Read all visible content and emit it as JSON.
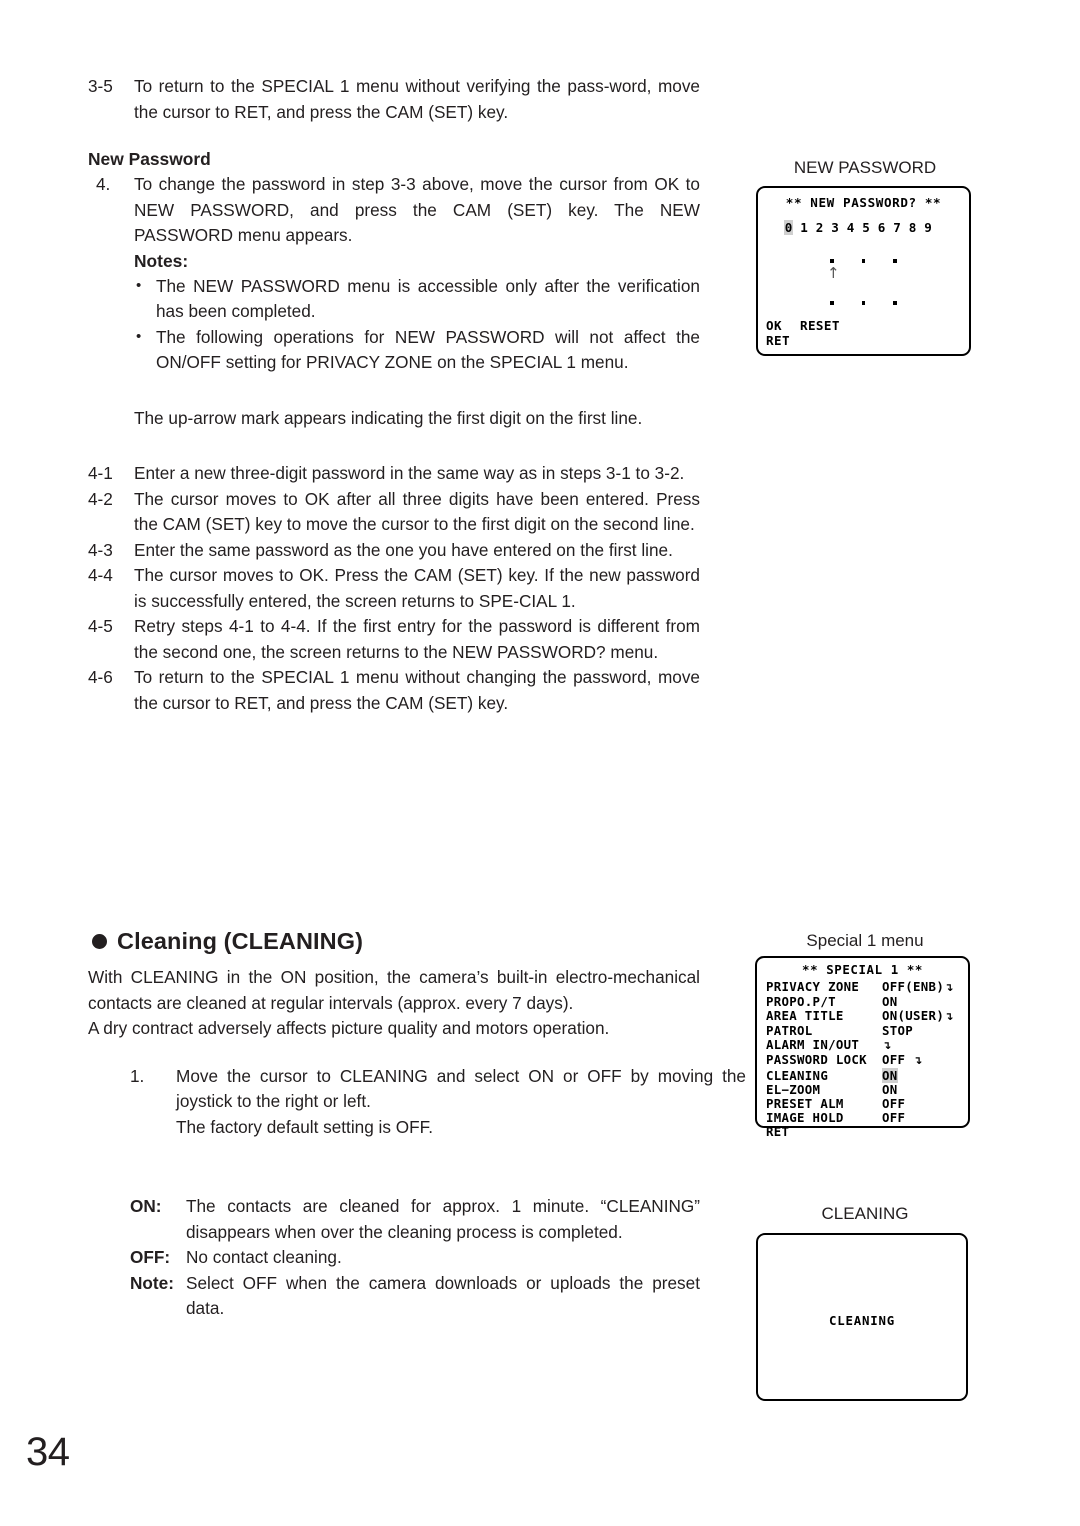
{
  "page": {
    "number": "34"
  },
  "left_column": {
    "step_3_5": {
      "marker": "3-5",
      "text": "To return to the SPECIAL 1 menu without verifying the pass-word, move the cursor to RET, and press the CAM (SET) key."
    },
    "new_password_heading": "New Password",
    "step_4": {
      "marker": "4.",
      "text": "To change the password in step 3-3 above, move the cursor from OK to NEW PASSWORD, and press the CAM (SET) key. The NEW PASSWORD menu appears."
    },
    "notes_heading": "Notes:",
    "notes": [
      "The NEW PASSWORD menu is accessible only after the verification has been completed.",
      "The following operations for NEW PASSWORD will not affect the ON/OFF setting for PRIVACY ZONE on the SPECIAL 1 menu."
    ],
    "uparrow_paragraph": "The up-arrow mark appears indicating the first digit on the first line.",
    "steps_4x": [
      {
        "marker": "4-1",
        "text": "Enter a new three-digit password in the same way as in steps 3-1 to 3-2."
      },
      {
        "marker": "4-2",
        "text": "The cursor moves to OK after all three digits have been entered. Press the CAM (SET) key to move the cursor to the first digit on the second line."
      },
      {
        "marker": "4-3",
        "text": "Enter the same password as the one you have entered on the first line."
      },
      {
        "marker": "4-4",
        "text": "The cursor moves to OK. Press the CAM (SET) key. If the new password is successfully entered, the screen returns to SPE-CIAL 1."
      },
      {
        "marker": "4-5",
        "text": "Retry steps 4-1 to 4-4. If the first entry for the password is different from the second one, the screen returns to the NEW PASSWORD? menu."
      },
      {
        "marker": "4-6",
        "text": "To return to the SPECIAL 1 menu without changing the password, move the cursor to RET, and press the CAM (SET) key."
      }
    ],
    "cleaning_section": {
      "heading": "Cleaning (CLEANING)",
      "para1": "With CLEANING in the ON position, the camera’s built-in electro-mechanical contacts are cleaned at regular intervals (approx. every 7 days).",
      "para2": "A dry contract adversely affects picture quality and motors operation.",
      "step_1": {
        "marker": "1.",
        "text": "Move the cursor to CLEANING and select ON or OFF by moving the joystick to the right or left."
      },
      "step_1_extra": "The factory default setting is OFF.",
      "definitions": [
        {
          "term": "ON:",
          "text": "The contacts are cleaned for approx. 1 minute. “CLEANING” disappears when over the cleaning process is completed."
        },
        {
          "term": "OFF:",
          "text": "No contact cleaning."
        },
        {
          "term": "Note:",
          "text": "Select OFF when the camera downloads or uploads the preset data."
        }
      ]
    }
  },
  "osd": {
    "new_password": {
      "caption": "NEW PASSWORD",
      "title": "**  NEW PASSWORD?  **",
      "digits": [
        "0",
        "1",
        "2",
        "3",
        "4",
        "5",
        "6",
        "7",
        "8",
        "9"
      ],
      "selected_digit_index": 0,
      "entry_rows": 2,
      "entry_dots_per_row": 3,
      "cursor_marker": "↑",
      "footer_ok": "OK",
      "footer_reset": "RESET",
      "footer_ret": "RET"
    },
    "special1": {
      "caption": "Special 1 menu",
      "title": "** SPECIAL 1 **",
      "rows": [
        {
          "label": "PRIVACY ZONE",
          "value": "OFF(ENB)",
          "arrow": true,
          "highlight": false
        },
        {
          "label": "PROPO.P/T",
          "value": "ON",
          "arrow": false,
          "highlight": false
        },
        {
          "label": "AREA TITLE",
          "value": "ON(USER)",
          "arrow": true,
          "highlight": false
        },
        {
          "label": "PATROL",
          "value": "STOP",
          "arrow": false,
          "highlight": false
        },
        {
          "label": "ALARM IN/OUT",
          "value": "",
          "arrow": true,
          "highlight": false
        },
        {
          "label": "PASSWORD LOCK",
          "value": "OFF ",
          "arrow": true,
          "highlight": false
        },
        {
          "label": "CLEANING",
          "value": "ON",
          "arrow": false,
          "highlight": true
        },
        {
          "label": "EL−ZOOM",
          "value": "ON",
          "arrow": false,
          "highlight": false
        },
        {
          "label": "PRESET ALM",
          "value": "OFF",
          "arrow": false,
          "highlight": false
        },
        {
          "label": "IMAGE HOLD",
          "value": "OFF",
          "arrow": false,
          "highlight": false
        },
        {
          "label": "RET",
          "value": "",
          "arrow": false,
          "highlight": false
        }
      ],
      "arrow_glyph": "↴"
    },
    "cleaning": {
      "caption": "CLEANING",
      "screen_text": "CLEANING"
    }
  }
}
